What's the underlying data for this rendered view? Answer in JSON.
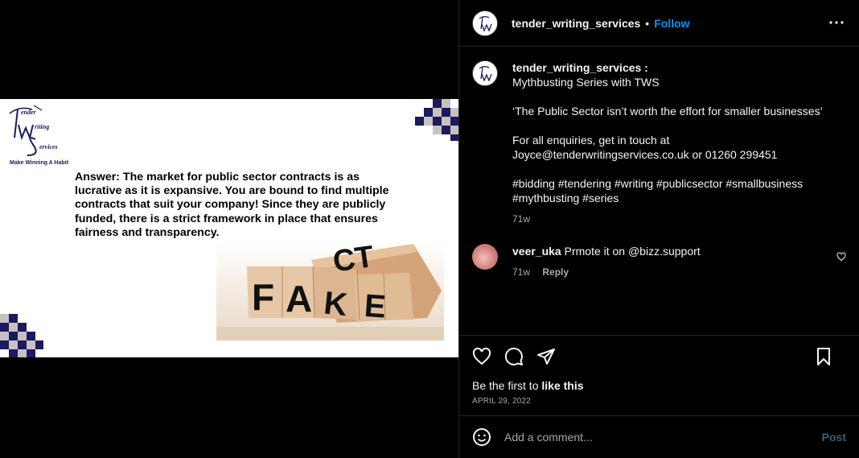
{
  "post_image": {
    "logo_tagline": "Make Winning A Habit",
    "logo_letters": [
      "T",
      "ender",
      "W",
      "riting",
      "S",
      "ervices"
    ],
    "answer_text": "Answer:  The market for public sector contracts is as lucrative as it is expansive. You are bound to find multiple contracts that suit your company! Since they are publicly funded, there is a strict framework in place that ensures fairness and transparency.",
    "blocks_top": "CT",
    "blocks_bottom": [
      "F",
      "A",
      "K",
      "E"
    ]
  },
  "header": {
    "username": "tender_writing_services",
    "separator": "•",
    "follow_label": "Follow"
  },
  "caption": {
    "username": "tender_writing_services :",
    "lines": [
      "Mythbusting Series with TWS",
      "",
      "‘The Public Sector isn’t worth the effort for smaller businesses’",
      "",
      "For all enquiries, get in touch at",
      "Joyce@tenderwritingservices.co.uk or 01260 299451",
      "",
      "#bidding #tendering #writing #publicsector #smallbusiness",
      "#mythbusting #series"
    ],
    "time": "71w"
  },
  "comment": {
    "username": "veer_uka",
    "text": "Prmote it on @bizz.support",
    "time": "71w",
    "reply_label": "Reply"
  },
  "actions": {
    "likes_prefix": "Be the first to",
    "likes_bold": "like this",
    "date": "APRIL 29, 2022"
  },
  "add_comment": {
    "placeholder": "Add a comment...",
    "post_label": "Post"
  },
  "colors": {
    "accent": "#0095f6",
    "background": "#000000",
    "border": "#262626",
    "muted": "#a8a8a8",
    "navy": "#1a1a5e"
  }
}
